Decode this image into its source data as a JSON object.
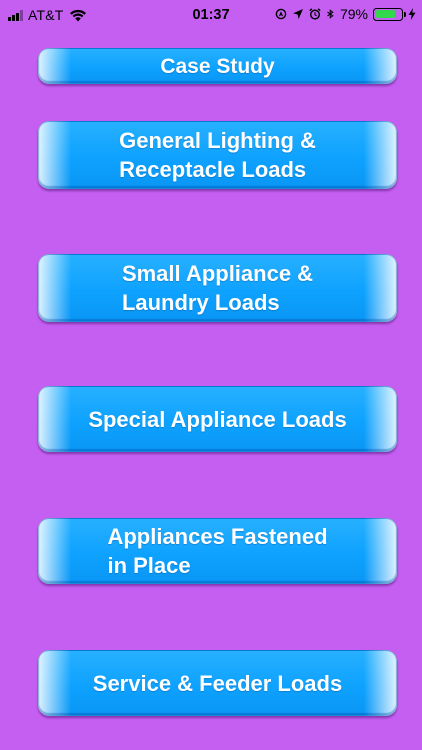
{
  "status_bar": {
    "carrier": "AT&T",
    "time": "01:37",
    "battery_percent_text": "79%",
    "battery_level": 0.79,
    "icons": [
      "signal-icon",
      "wifi-icon",
      "location-lock-icon",
      "location-arrow-icon",
      "alarm-icon",
      "bluetooth-icon",
      "battery-icon",
      "charging-bolt-icon"
    ]
  },
  "menu": {
    "items": [
      {
        "label": "Case Study"
      },
      {
        "label": "General Lighting &\nReceptacle Loads"
      },
      {
        "label": "Small Appliance &\nLaundry Loads"
      },
      {
        "label": "Special Appliance Loads"
      },
      {
        "label": "Appliances Fastened\nin Place"
      },
      {
        "label": "Service & Feeder Loads"
      }
    ]
  },
  "colors": {
    "background": "#c45ff2",
    "button": "#0ea2ff",
    "button_text": "#ffffff",
    "battery_fill": "#32d74b"
  }
}
